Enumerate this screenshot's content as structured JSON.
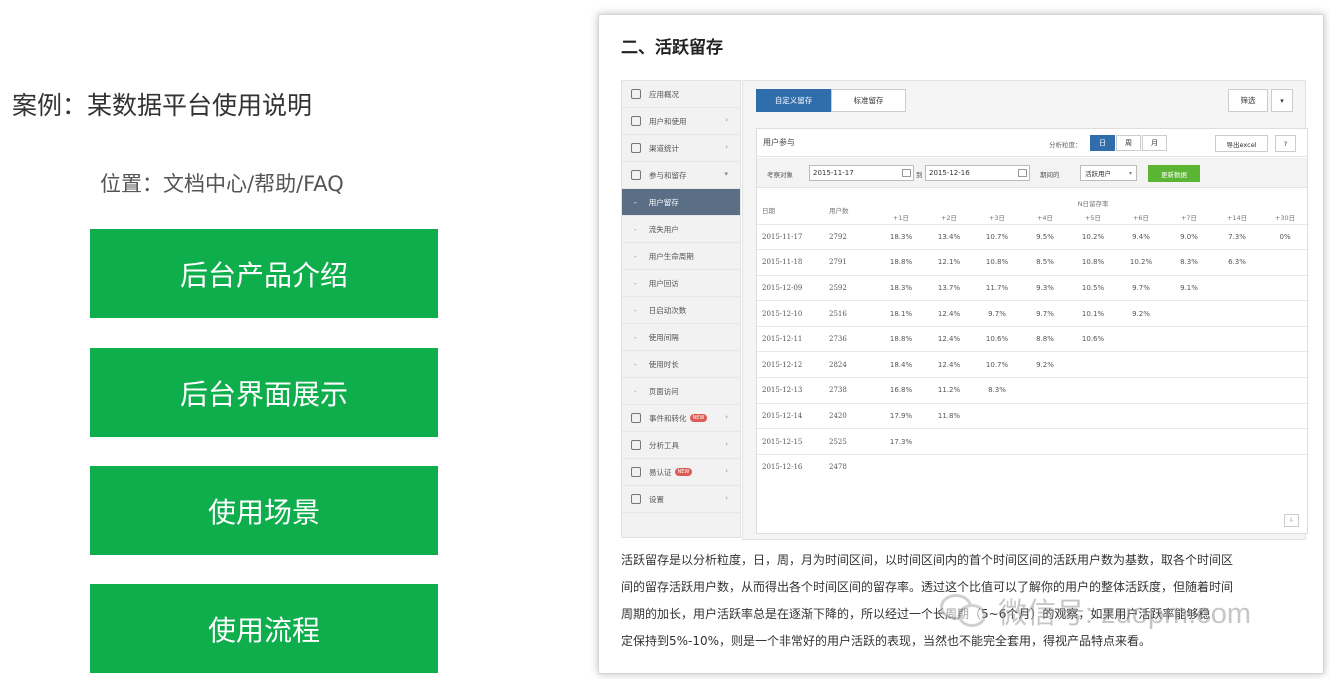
{
  "slide": {
    "title": "案例：某数据平台使用说明",
    "location": "位置：文档中心/帮助/FAQ",
    "buttons": [
      "后台产品介绍",
      "后台界面展示",
      "使用场景",
      "使用流程"
    ]
  },
  "panel": {
    "heading": "二、活跃留存",
    "sidebar": {
      "top_items": [
        {
          "label": "应用概况",
          "icon": "overview-icon"
        },
        {
          "label": "用户和使用",
          "icon": "users-icon"
        },
        {
          "label": "渠道统计",
          "icon": "channel-icon"
        },
        {
          "label": "参与和留存",
          "icon": "retention-icon"
        }
      ],
      "sub_items": [
        "用户留存",
        "流失用户",
        "用户生命周期",
        "用户回访",
        "日启动次数",
        "使用间隔",
        "使用时长",
        "页面访问"
      ],
      "bottom_items": [
        {
          "label": "事件和转化",
          "icon": "event-icon",
          "badge": "NEW"
        },
        {
          "label": "分析工具",
          "icon": "eye-icon"
        },
        {
          "label": "易认证",
          "icon": "cert-icon",
          "badge": "NEW"
        },
        {
          "label": "设置",
          "icon": "gear-icon"
        }
      ]
    },
    "tabs": {
      "custom": "自定义留存",
      "standard": "标准留存"
    },
    "filter": {
      "label": "筛选",
      "caret": "▾"
    },
    "card": {
      "title": "用户参与",
      "granularity_label": "分析粒度：",
      "granularity": [
        "日",
        "周",
        "月"
      ],
      "export": "导出excel",
      "help": "?",
      "target_label": "考察对象",
      "date_from": "2015-11-17",
      "to_label": "到",
      "date_to": "2015-12-16",
      "period_label": "期间的",
      "select_value": "活跃用户",
      "update": "更新数据",
      "header": {
        "date": "日期",
        "users": "用户数",
        "group": "N日留存率",
        "days": [
          "+1日",
          "+2日",
          "+3日",
          "+4日",
          "+5日",
          "+6日",
          "+7日",
          "+14日",
          "+30日"
        ]
      },
      "rows": [
        {
          "date": "2015-11-17",
          "users": "2792",
          "rates": [
            "18.3%",
            "13.4%",
            "10.7%",
            "9.5%",
            "10.2%",
            "9.4%",
            "9.0%",
            "7.3%",
            "0%"
          ]
        },
        {
          "date": "2015-11-18",
          "users": "2791",
          "rates": [
            "18.8%",
            "12.1%",
            "10.8%",
            "8.5%",
            "10.8%",
            "10.2%",
            "8.3%",
            "6.3%",
            ""
          ]
        },
        {
          "date": "2015-12-09",
          "users": "2592",
          "rates": [
            "18.3%",
            "13.7%",
            "11.7%",
            "9.3%",
            "10.5%",
            "9.7%",
            "9.1%",
            "",
            ""
          ]
        },
        {
          "date": "2015-12-10",
          "users": "2516",
          "rates": [
            "18.1%",
            "12.4%",
            "9.7%",
            "9.7%",
            "10.1%",
            "9.2%",
            "",
            "",
            ""
          ]
        },
        {
          "date": "2015-12-11",
          "users": "2736",
          "rates": [
            "18.8%",
            "12.4%",
            "10.6%",
            "8.8%",
            "10.6%",
            "",
            "",
            "",
            ""
          ]
        },
        {
          "date": "2015-12-12",
          "users": "2824",
          "rates": [
            "18.4%",
            "12.4%",
            "10.7%",
            "9.2%",
            "",
            "",
            "",
            "",
            ""
          ]
        },
        {
          "date": "2015-12-13",
          "users": "2738",
          "rates": [
            "16.8%",
            "11.2%",
            "8.3%",
            "",
            "",
            "",
            "",
            "",
            ""
          ]
        },
        {
          "date": "2015-12-14",
          "users": "2420",
          "rates": [
            "17.9%",
            "11.8%",
            "",
            "",
            "",
            "",
            "",
            "",
            ""
          ]
        },
        {
          "date": "2015-12-15",
          "users": "2525",
          "rates": [
            "17.3%",
            "",
            "",
            "",
            "",
            "",
            "",
            "",
            ""
          ]
        },
        {
          "date": "2015-12-16",
          "users": "2478",
          "rates": [
            "",
            "",
            "",
            "",
            "",
            "",
            "",
            "",
            ""
          ]
        }
      ]
    },
    "description": [
      "活跃留存是以分析粒度，日，周，月为时间区间，以时间区间内的首个时间区间的活跃用户数为基数，取各个时间区",
      "间的留存活跃用户数，从而得出各个时间区间的留存率。透过这个比值可以了解你的用户的整体活跃度，但随着时间",
      "周期的加长，用户活跃率总是在逐渐下降的，所以经过一个长周期（5~6个月）的观察，如果用户活跃率能够稳",
      "定保持到5%-10%，则是一个非常好的用户活跃的表现，当然也不能完全套用，得视产品特点来看。"
    ]
  },
  "watermark": {
    "text": "微信号: zuopm.com"
  },
  "colors": {
    "green_button": "#0fae4c",
    "tab_active": "#2f6eab",
    "sidebar_active": "#5a6f86",
    "update_button": "#5ab533"
  }
}
